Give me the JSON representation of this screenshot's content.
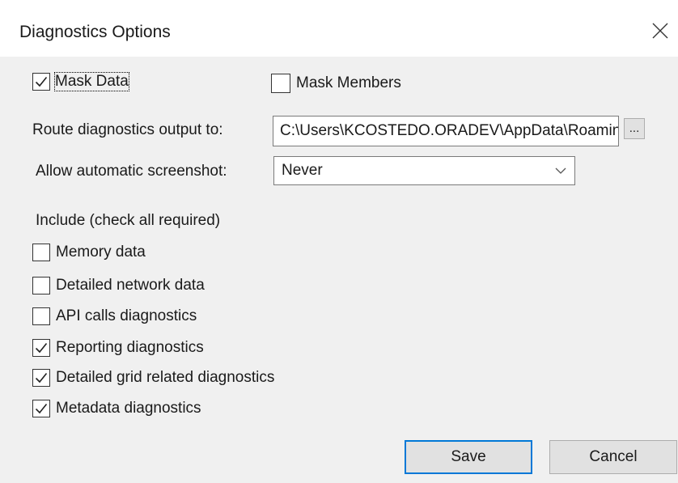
{
  "dialog": {
    "title": "Diagnostics Options",
    "close_icon": "close-icon"
  },
  "mask": {
    "mask_data": {
      "label": "Mask Data",
      "checked": true
    },
    "mask_members": {
      "label": "Mask Members",
      "checked": false
    }
  },
  "route": {
    "label": "Route diagnostics output to:",
    "value": "C:\\Users\\KCOSTEDO.ORADEV\\AppData\\Roaming",
    "browse_label": "..."
  },
  "screenshot": {
    "label": "Allow automatic screenshot:",
    "selected": "Never"
  },
  "include": {
    "heading": "Include (check all required)",
    "items": [
      {
        "label": "Memory data",
        "checked": false
      },
      {
        "label": "Detailed network data",
        "checked": false
      },
      {
        "label": "API calls diagnostics",
        "checked": false
      },
      {
        "label": "Reporting diagnostics",
        "checked": true
      },
      {
        "label": "Detailed grid related diagnostics",
        "checked": true
      },
      {
        "label": "Metadata diagnostics",
        "checked": true
      }
    ]
  },
  "buttons": {
    "save": "Save",
    "cancel": "Cancel"
  },
  "colors": {
    "dialog_bg": "#f0f0f0",
    "accent": "#0078d7"
  }
}
